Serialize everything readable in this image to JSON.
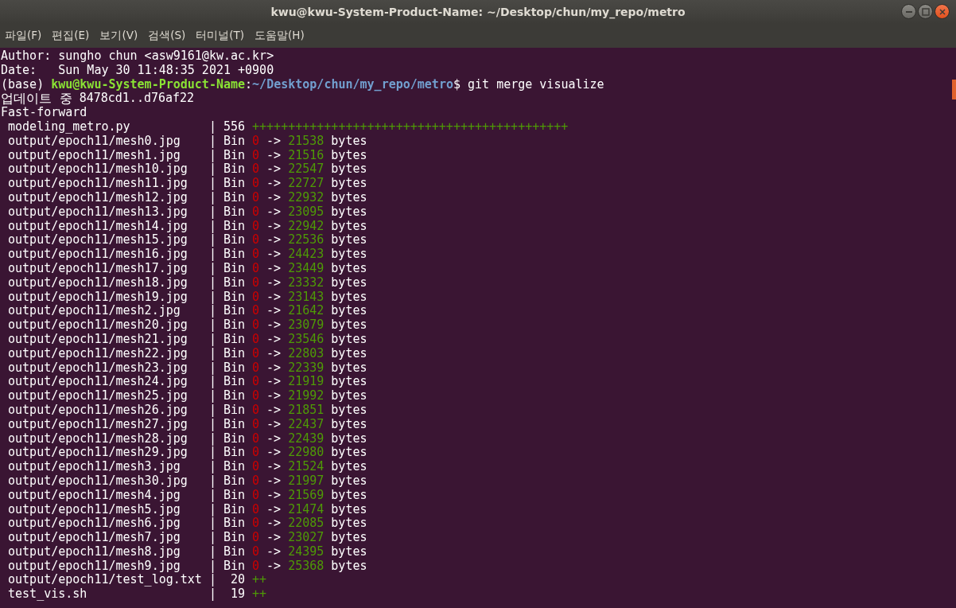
{
  "window": {
    "title": "kwu@kwu-System-Product-Name: ~/Desktop/chun/my_repo/metro"
  },
  "menu": [
    "파일(F)",
    "편집(E)",
    "보기(V)",
    "검색(S)",
    "터미널(T)",
    "도움말(H)"
  ],
  "header_lines": [
    "Author: sungho chun <asw9161@kw.ac.kr>",
    "Date:   Sun May 30 11:48:35 2021 +0900"
  ],
  "prompt": {
    "env": "(base)",
    "user_host": "kwu@kwu-System-Product-Name",
    "separator": ":",
    "path": "~/Desktop/chun/my_repo/metro",
    "command": "$ git merge visualize"
  },
  "update_line": {
    "label": "업데이트 중",
    "range": "8478cd1..d76af22"
  },
  "fast_forward": "Fast-forward",
  "stat_rows": [
    {
      "kind": "text",
      "name": "modeling_metro.py",
      "sep": "|",
      "count": "556",
      "plus": "++++++++++++++++++++++++++++++++++++++++++++"
    },
    {
      "kind": "bin",
      "name": "output/epoch11/mesh0.jpg",
      "sep": "|",
      "bin": "Bin",
      "old": "0",
      "arrow": "->",
      "new": "21538",
      "unit": "bytes"
    },
    {
      "kind": "bin",
      "name": "output/epoch11/mesh1.jpg",
      "sep": "|",
      "bin": "Bin",
      "old": "0",
      "arrow": "->",
      "new": "21516",
      "unit": "bytes"
    },
    {
      "kind": "bin",
      "name": "output/epoch11/mesh10.jpg",
      "sep": "|",
      "bin": "Bin",
      "old": "0",
      "arrow": "->",
      "new": "22547",
      "unit": "bytes"
    },
    {
      "kind": "bin",
      "name": "output/epoch11/mesh11.jpg",
      "sep": "|",
      "bin": "Bin",
      "old": "0",
      "arrow": "->",
      "new": "22727",
      "unit": "bytes"
    },
    {
      "kind": "bin",
      "name": "output/epoch11/mesh12.jpg",
      "sep": "|",
      "bin": "Bin",
      "old": "0",
      "arrow": "->",
      "new": "22932",
      "unit": "bytes"
    },
    {
      "kind": "bin",
      "name": "output/epoch11/mesh13.jpg",
      "sep": "|",
      "bin": "Bin",
      "old": "0",
      "arrow": "->",
      "new": "23095",
      "unit": "bytes"
    },
    {
      "kind": "bin",
      "name": "output/epoch11/mesh14.jpg",
      "sep": "|",
      "bin": "Bin",
      "old": "0",
      "arrow": "->",
      "new": "22942",
      "unit": "bytes"
    },
    {
      "kind": "bin",
      "name": "output/epoch11/mesh15.jpg",
      "sep": "|",
      "bin": "Bin",
      "old": "0",
      "arrow": "->",
      "new": "22536",
      "unit": "bytes"
    },
    {
      "kind": "bin",
      "name": "output/epoch11/mesh16.jpg",
      "sep": "|",
      "bin": "Bin",
      "old": "0",
      "arrow": "->",
      "new": "24423",
      "unit": "bytes"
    },
    {
      "kind": "bin",
      "name": "output/epoch11/mesh17.jpg",
      "sep": "|",
      "bin": "Bin",
      "old": "0",
      "arrow": "->",
      "new": "23449",
      "unit": "bytes"
    },
    {
      "kind": "bin",
      "name": "output/epoch11/mesh18.jpg",
      "sep": "|",
      "bin": "Bin",
      "old": "0",
      "arrow": "->",
      "new": "23332",
      "unit": "bytes"
    },
    {
      "kind": "bin",
      "name": "output/epoch11/mesh19.jpg",
      "sep": "|",
      "bin": "Bin",
      "old": "0",
      "arrow": "->",
      "new": "23143",
      "unit": "bytes"
    },
    {
      "kind": "bin",
      "name": "output/epoch11/mesh2.jpg",
      "sep": "|",
      "bin": "Bin",
      "old": "0",
      "arrow": "->",
      "new": "21642",
      "unit": "bytes"
    },
    {
      "kind": "bin",
      "name": "output/epoch11/mesh20.jpg",
      "sep": "|",
      "bin": "Bin",
      "old": "0",
      "arrow": "->",
      "new": "23079",
      "unit": "bytes"
    },
    {
      "kind": "bin",
      "name": "output/epoch11/mesh21.jpg",
      "sep": "|",
      "bin": "Bin",
      "old": "0",
      "arrow": "->",
      "new": "23546",
      "unit": "bytes"
    },
    {
      "kind": "bin",
      "name": "output/epoch11/mesh22.jpg",
      "sep": "|",
      "bin": "Bin",
      "old": "0",
      "arrow": "->",
      "new": "22803",
      "unit": "bytes"
    },
    {
      "kind": "bin",
      "name": "output/epoch11/mesh23.jpg",
      "sep": "|",
      "bin": "Bin",
      "old": "0",
      "arrow": "->",
      "new": "22339",
      "unit": "bytes"
    },
    {
      "kind": "bin",
      "name": "output/epoch11/mesh24.jpg",
      "sep": "|",
      "bin": "Bin",
      "old": "0",
      "arrow": "->",
      "new": "21919",
      "unit": "bytes"
    },
    {
      "kind": "bin",
      "name": "output/epoch11/mesh25.jpg",
      "sep": "|",
      "bin": "Bin",
      "old": "0",
      "arrow": "->",
      "new": "21992",
      "unit": "bytes"
    },
    {
      "kind": "bin",
      "name": "output/epoch11/mesh26.jpg",
      "sep": "|",
      "bin": "Bin",
      "old": "0",
      "arrow": "->",
      "new": "21851",
      "unit": "bytes"
    },
    {
      "kind": "bin",
      "name": "output/epoch11/mesh27.jpg",
      "sep": "|",
      "bin": "Bin",
      "old": "0",
      "arrow": "->",
      "new": "22437",
      "unit": "bytes"
    },
    {
      "kind": "bin",
      "name": "output/epoch11/mesh28.jpg",
      "sep": "|",
      "bin": "Bin",
      "old": "0",
      "arrow": "->",
      "new": "22439",
      "unit": "bytes"
    },
    {
      "kind": "bin",
      "name": "output/epoch11/mesh29.jpg",
      "sep": "|",
      "bin": "Bin",
      "old": "0",
      "arrow": "->",
      "new": "22980",
      "unit": "bytes"
    },
    {
      "kind": "bin",
      "name": "output/epoch11/mesh3.jpg",
      "sep": "|",
      "bin": "Bin",
      "old": "0",
      "arrow": "->",
      "new": "21524",
      "unit": "bytes"
    },
    {
      "kind": "bin",
      "name": "output/epoch11/mesh30.jpg",
      "sep": "|",
      "bin": "Bin",
      "old": "0",
      "arrow": "->",
      "new": "21997",
      "unit": "bytes"
    },
    {
      "kind": "bin",
      "name": "output/epoch11/mesh4.jpg",
      "sep": "|",
      "bin": "Bin",
      "old": "0",
      "arrow": "->",
      "new": "21569",
      "unit": "bytes"
    },
    {
      "kind": "bin",
      "name": "output/epoch11/mesh5.jpg",
      "sep": "|",
      "bin": "Bin",
      "old": "0",
      "arrow": "->",
      "new": "21474",
      "unit": "bytes"
    },
    {
      "kind": "bin",
      "name": "output/epoch11/mesh6.jpg",
      "sep": "|",
      "bin": "Bin",
      "old": "0",
      "arrow": "->",
      "new": "22085",
      "unit": "bytes"
    },
    {
      "kind": "bin",
      "name": "output/epoch11/mesh7.jpg",
      "sep": "|",
      "bin": "Bin",
      "old": "0",
      "arrow": "->",
      "new": "23027",
      "unit": "bytes"
    },
    {
      "kind": "bin",
      "name": "output/epoch11/mesh8.jpg",
      "sep": "|",
      "bin": "Bin",
      "old": "0",
      "arrow": "->",
      "new": "24395",
      "unit": "bytes"
    },
    {
      "kind": "bin",
      "name": "output/epoch11/mesh9.jpg",
      "sep": "|",
      "bin": "Bin",
      "old": "0",
      "arrow": "->",
      "new": "25368",
      "unit": "bytes"
    },
    {
      "kind": "text",
      "name": "output/epoch11/test_log.txt",
      "sep": "|",
      "count": "20",
      "plus": "++"
    },
    {
      "kind": "text",
      "name": "test_vis.sh",
      "sep": "|",
      "count": "19",
      "plus": "++"
    }
  ]
}
